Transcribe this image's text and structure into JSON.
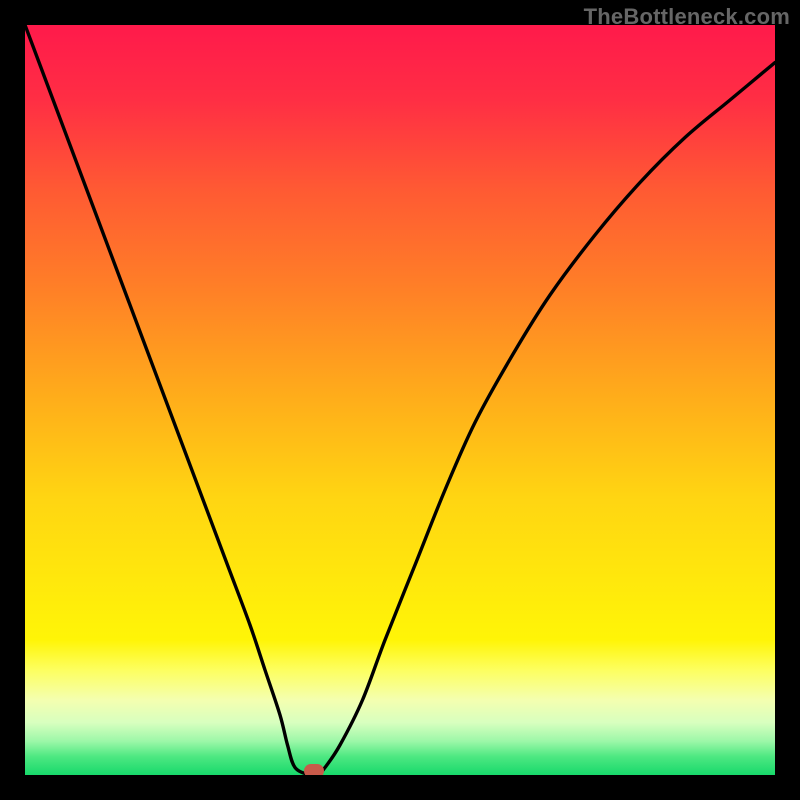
{
  "watermark": "TheBottleneck.com",
  "chart_data": {
    "type": "line",
    "title": "",
    "xlabel": "",
    "ylabel": "",
    "xlim": [
      0,
      100
    ],
    "ylim": [
      0,
      100
    ],
    "series": [
      {
        "name": "bottleneck-curve",
        "x": [
          0,
          3,
          6,
          9,
          12,
          15,
          18,
          21,
          24,
          27,
          30,
          32,
          34,
          35,
          36,
          38,
          39,
          40,
          42,
          45,
          48,
          52,
          56,
          60,
          65,
          70,
          76,
          82,
          88,
          94,
          100
        ],
        "y": [
          100,
          92,
          84,
          76,
          68,
          60,
          52,
          44,
          36,
          28,
          20,
          14,
          8,
          4,
          1,
          0,
          0,
          1,
          4,
          10,
          18,
          28,
          38,
          47,
          56,
          64,
          72,
          79,
          85,
          90,
          95
        ]
      }
    ],
    "marker": {
      "x": 38.5,
      "y": 0
    },
    "gradient_stops": [
      {
        "offset": 0.0,
        "color": "#ff1a4b"
      },
      {
        "offset": 0.1,
        "color": "#ff2e44"
      },
      {
        "offset": 0.22,
        "color": "#ff5a33"
      },
      {
        "offset": 0.35,
        "color": "#ff7f27"
      },
      {
        "offset": 0.5,
        "color": "#ffae1a"
      },
      {
        "offset": 0.63,
        "color": "#ffd512"
      },
      {
        "offset": 0.74,
        "color": "#ffe80c"
      },
      {
        "offset": 0.82,
        "color": "#fff507"
      },
      {
        "offset": 0.86,
        "color": "#fdff60"
      },
      {
        "offset": 0.9,
        "color": "#f4ffb0"
      },
      {
        "offset": 0.93,
        "color": "#d8ffbf"
      },
      {
        "offset": 0.955,
        "color": "#9cf7a8"
      },
      {
        "offset": 0.975,
        "color": "#4fe882"
      },
      {
        "offset": 1.0,
        "color": "#17d96b"
      }
    ]
  }
}
